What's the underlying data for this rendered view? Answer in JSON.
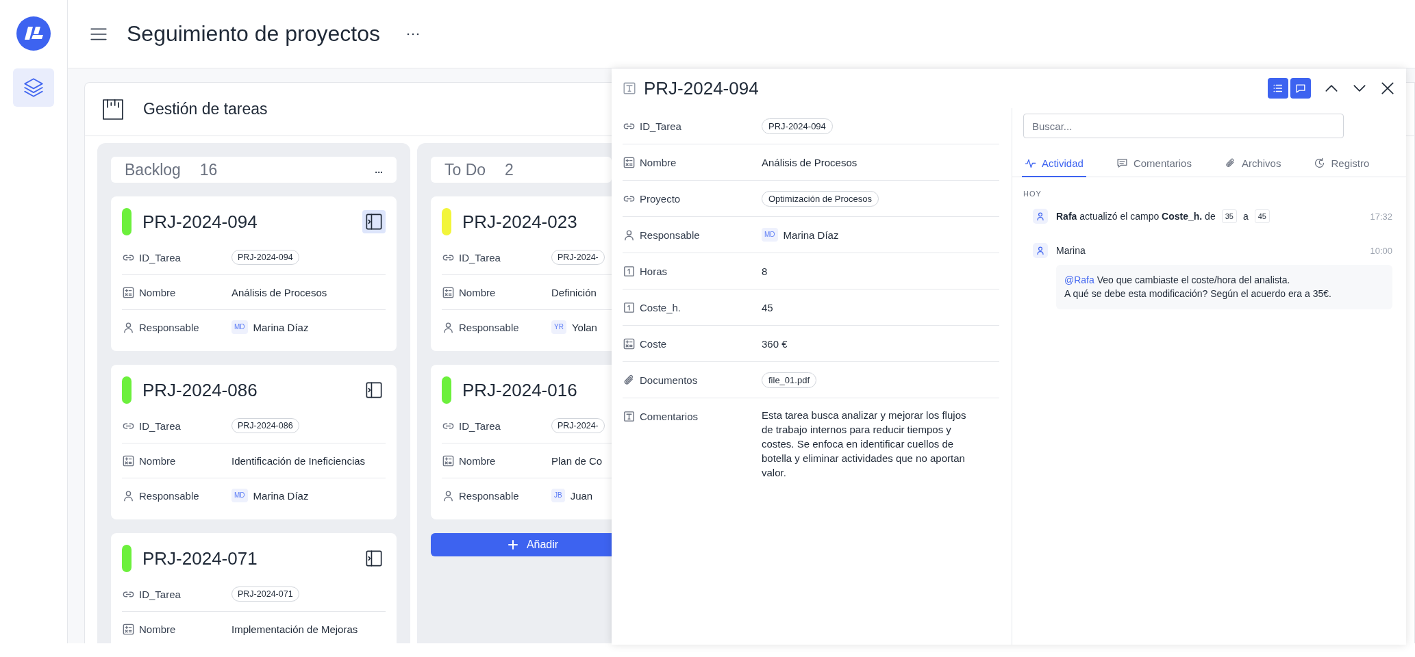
{
  "app": {
    "title": "Seguimiento de proyectos"
  },
  "board": {
    "title": "Gestión de tareas",
    "columns": [
      {
        "name": "Backlog",
        "count": "16",
        "more": "...",
        "cards": [
          {
            "id": "PRJ-2024-094",
            "color": "#6cf03c",
            "selected": true,
            "fields": [
              {
                "kind": "link",
                "label": "ID_Tarea",
                "value": "PRJ-2024-094"
              },
              {
                "kind": "formula",
                "label": "Nombre",
                "value": "Análisis de Procesos"
              },
              {
                "kind": "person",
                "label": "Responsable",
                "initials": "MD",
                "value": "Marina Díaz"
              }
            ]
          },
          {
            "id": "PRJ-2024-086",
            "color": "#6cf03c",
            "selected": false,
            "fields": [
              {
                "kind": "link",
                "label": "ID_Tarea",
                "value": "PRJ-2024-086"
              },
              {
                "kind": "formula",
                "label": "Nombre",
                "value": "Identificación de Ineficiencias"
              },
              {
                "kind": "person",
                "label": "Responsable",
                "initials": "MD",
                "value": "Marina Díaz"
              }
            ]
          },
          {
            "id": "PRJ-2024-071",
            "color": "#6cf03c",
            "selected": false,
            "fields": [
              {
                "kind": "link",
                "label": "ID_Tarea",
                "value": "PRJ-2024-071"
              },
              {
                "kind": "formula",
                "label": "Nombre",
                "value": "Implementación de Mejoras"
              }
            ]
          }
        ]
      },
      {
        "name": "To Do",
        "count": "2",
        "add_button": "Añadir",
        "cards": [
          {
            "id": "PRJ-2024-023",
            "color": "#f2f53a",
            "fields": [
              {
                "kind": "link",
                "label": "ID_Tarea",
                "value": "PRJ-2024-"
              },
              {
                "kind": "formula",
                "label": "Nombre",
                "value": "Definición"
              },
              {
                "kind": "person",
                "label": "Responsable",
                "initials": "YR",
                "value": "Yolan"
              }
            ]
          },
          {
            "id": "PRJ-2024-016",
            "color": "#6cf03c",
            "fields": [
              {
                "kind": "link",
                "label": "ID_Tarea",
                "value": "PRJ-2024-"
              },
              {
                "kind": "formula",
                "label": "Nombre",
                "value": "Plan de Co"
              },
              {
                "kind": "person",
                "label": "Responsable",
                "initials": "JB",
                "value": "Juan"
              }
            ]
          }
        ]
      }
    ]
  },
  "detail": {
    "title": "PRJ-2024-094",
    "view_buttons": [
      {
        "kind": "list",
        "selected": true
      },
      {
        "kind": "chat",
        "selected": true
      }
    ],
    "fields": [
      {
        "kind": "link",
        "label": "ID_Tarea",
        "value": "PRJ-2024-094"
      },
      {
        "kind": "formula",
        "label": "Nombre",
        "value": "Análisis de Procesos"
      },
      {
        "kind": "link",
        "label": "Proyecto",
        "value": "Optimización de Procesos"
      },
      {
        "kind": "person",
        "label": "Responsable",
        "initials": "MD",
        "value": "Marina Díaz"
      },
      {
        "kind": "number",
        "label": "Horas",
        "value": "8"
      },
      {
        "kind": "number",
        "label": "Coste_h.",
        "value": "45"
      },
      {
        "kind": "formula",
        "label": "Coste",
        "value": "360 €"
      },
      {
        "kind": "attachment",
        "label": "Documentos",
        "value": "file_01.pdf"
      },
      {
        "kind": "text",
        "label": "Comentarios",
        "value": "Esta tarea busca analizar y mejorar los flujos de trabajo internos para reducir tiempos y costes. Se enfoca en identificar cuellos de botella y eliminar actividades que no aportan valor."
      }
    ],
    "search": {
      "placeholder": "Buscar..."
    },
    "tabs": [
      {
        "kind": "activity",
        "label": "Actividad",
        "selected": true
      },
      {
        "kind": "comments",
        "label": "Comentarios",
        "selected": false
      },
      {
        "kind": "files",
        "label": "Archivos",
        "selected": false
      },
      {
        "kind": "log",
        "label": "Registro",
        "selected": false
      }
    ],
    "day": "HOY",
    "activity": [
      {
        "kind": "change",
        "text": "**Rafa** actualizó el campo **Coste_h.** de",
        "from": "35",
        "connector": "a",
        "to": "45",
        "time": "17:32"
      },
      {
        "kind": "comment",
        "user": "Marina",
        "time": "10:00",
        "mention": "@Rafa",
        "lines": [
          "Veo que cambiaste el coste/hora del analista.",
          "A qué se debe esta modificación? Según el acuerdo era a 35€."
        ]
      }
    ]
  }
}
